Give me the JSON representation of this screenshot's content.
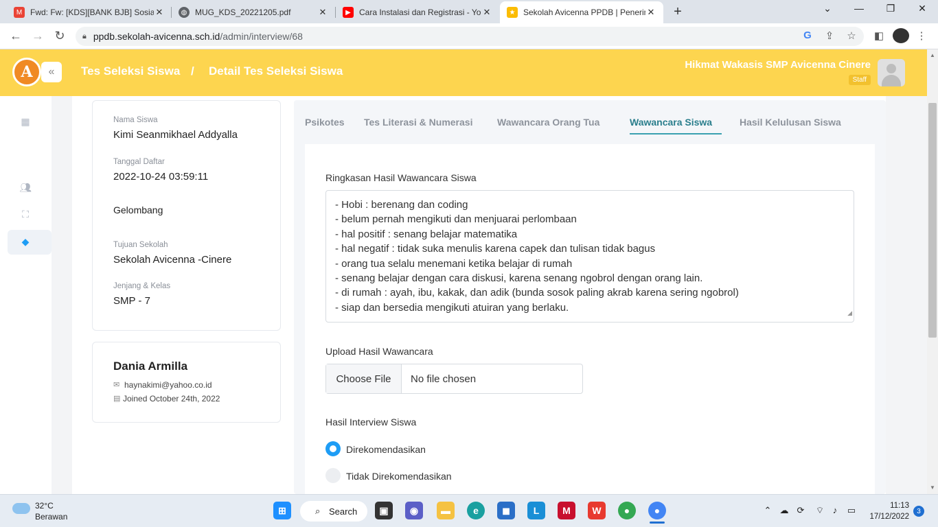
{
  "browser": {
    "tabs": [
      {
        "title": "Fwd: Fw: [KDS][BANK BJB] Sosiali",
        "icon": "gmail-icon",
        "color": "#ea4335"
      },
      {
        "title": "MUG_KDS_20221205.pdf",
        "icon": "globe-icon",
        "color": "#5f6368"
      },
      {
        "title": "Cara Instalasi dan Registrasi - You",
        "icon": "youtube-icon",
        "color": "#ff0000"
      },
      {
        "title": "Sekolah Avicenna PPDB | Penerim",
        "icon": "school-icon",
        "color": "#fbbc04"
      }
    ],
    "url_host": "ppdb.sekolah-avicenna.sch.id",
    "url_path": "/admin/interview/68"
  },
  "header": {
    "logo_letter": "A",
    "breadcrumb_1": "Tes Seleksi Siswa",
    "breadcrumb_sep": "/",
    "breadcrumb_2": "Detail Tes Seleksi Siswa",
    "user_name": "Hikmat Wakasis SMP Avicenna Cinere",
    "user_role": "Staff",
    "accent": "#fdd54f"
  },
  "student": {
    "name_label": "Nama Siswa",
    "name": "Kimi Seanmikhael Addyalla",
    "date_label": "Tanggal Daftar",
    "date": "2022-10-24 03:59:11",
    "wave_label": "Gelombang",
    "school_label": "Tujuan Sekolah",
    "school": "Sekolah Avicenna -Cinere",
    "grade_label": "Jenjang & Kelas",
    "grade": "SMP - 7"
  },
  "parent": {
    "name": "Dania Armilla",
    "email": "haynakimi@yahoo.co.id",
    "joined": "Joined October 24th, 2022"
  },
  "tabs": [
    {
      "label": "Psikotes"
    },
    {
      "label": "Tes Literasi & Numerasi"
    },
    {
      "label": "Wawancara Orang Tua"
    },
    {
      "label": "Wawancara Siswa"
    },
    {
      "label": "Hasil Kelulusan Siswa"
    }
  ],
  "active_tab": "Wawancara Siswa",
  "form": {
    "summary_label": "Ringkasan Hasil Wawancara Siswa",
    "summary_lines": [
      "- Hobi : berenang dan coding",
      "- belum pernah mengikuti dan menjuarai perlombaan",
      "- hal positif : senang belajar matematika",
      "- hal negatif : tidak suka menulis karena capek dan tulisan tidak bagus",
      "- orang tua selalu menemani ketika belajar di rumah",
      "- senang belajar dengan cara diskusi, karena senang ngobrol dengan orang lain.",
      "- di rumah : ayah, ibu, kakak, dan adik (bunda sosok paling akrab karena sering ngobrol)",
      "- siap dan bersedia mengikuti atuiran yang berlaku."
    ],
    "upload_label": "Upload Hasil Wawancara",
    "choose_file": "Choose File",
    "no_file": "No file chosen",
    "result_label": "Hasil Interview Siswa",
    "option_recommended": "Direkomendasikan",
    "option_not_recommended": "Tidak Direkomendasikan",
    "selected": "Direkomendasikan"
  },
  "taskbar": {
    "temp": "32°C",
    "weather": "Berawan",
    "search": "Search",
    "time": "11:13",
    "date": "17/12/2022",
    "notifications": "3"
  }
}
